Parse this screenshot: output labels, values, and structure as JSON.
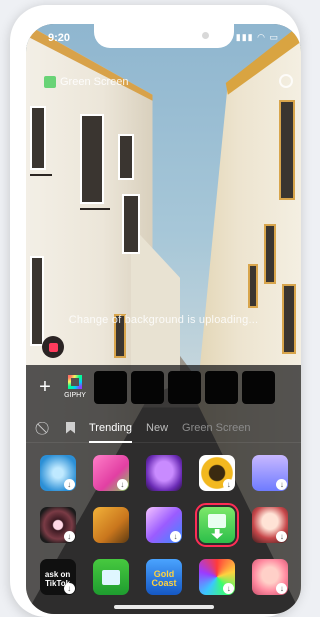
{
  "status": {
    "time": "9:20",
    "right": "▮▮▮ ◠ ▭"
  },
  "effect": {
    "title": "Green Screen"
  },
  "loading_text": "Change of background is uploading...",
  "toolbar": {
    "plus": "+",
    "giphy_label": "GIPHY"
  },
  "tabs": [
    {
      "label": "Trending",
      "active": true
    },
    {
      "label": "New",
      "active": false
    },
    {
      "label": "Green Screen",
      "active": false
    }
  ],
  "tiles": {
    "r3c1_text": "ask on TikTok",
    "r3c3_text": "Gold Coast"
  },
  "colors": {
    "accent": "#ff2d55",
    "panel": "#161618"
  }
}
